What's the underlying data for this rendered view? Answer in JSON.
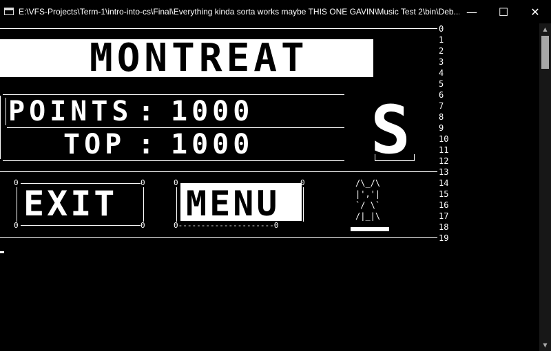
{
  "window": {
    "title": "E:\\VFS-Projects\\Term-1\\intro-into-cs\\Final\\Everything kinda sorta works maybe THIS ONE GAVIN\\Music Test 2\\bin\\Deb...",
    "min_glyph": "—",
    "max_glyph": "☐",
    "close_glyph": "✕"
  },
  "scrollbar": {
    "up": "▲",
    "down": "▼"
  },
  "row_numbers": [
    "0",
    "1",
    "2",
    "3",
    "4",
    "5",
    "6",
    "7",
    "8",
    "9",
    "10",
    "11",
    "12",
    "13",
    "14",
    "15",
    "16",
    "17",
    "18",
    "19"
  ],
  "banner": {
    "title": "MONTREAT"
  },
  "scores": {
    "points_label": "POINTS",
    "points_value": "1000",
    "top_label": "TOP",
    "top_value": "1000",
    "separator": ":"
  },
  "grade": {
    "letter": "S"
  },
  "buttons": {
    "exit_label": "EXIT",
    "menu_label": "MENU",
    "corner": "0",
    "menu_bottom": "0---------------------0"
  },
  "ascii_art": "/\\_/\\\n|','|\n`/ \\`\n/|_|\\",
  "colors": {
    "background": "#000000",
    "foreground": "#ffffff"
  }
}
